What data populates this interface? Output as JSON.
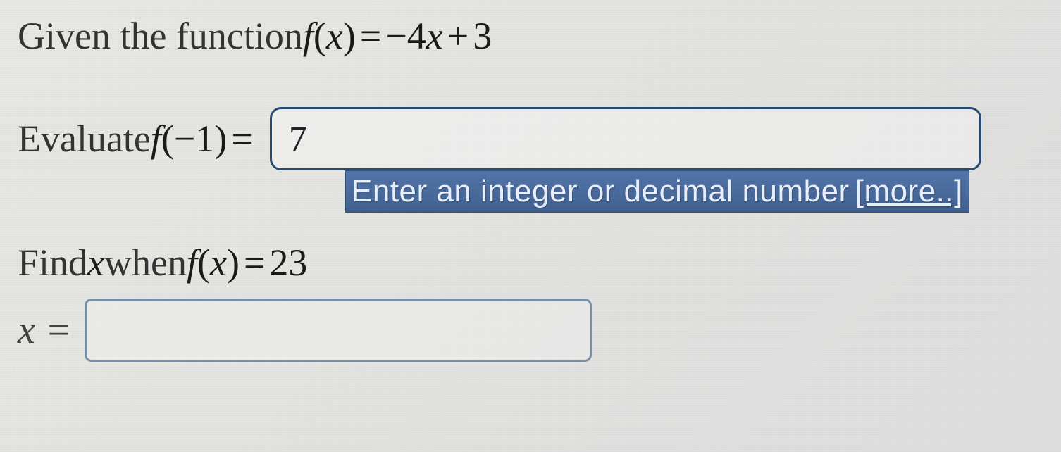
{
  "prompt": {
    "intro_text": "Given the function ",
    "function_def": "f(x) = −4x + 3"
  },
  "q1": {
    "label_text": "Evaluate ",
    "math_label": "f(−1) =",
    "input_value": "7",
    "hint_text": "Enter an integer or decimal number ",
    "hint_link": "[more..]"
  },
  "q2": {
    "label_text": "Find ",
    "var_text": "x",
    "when_text": " when ",
    "math_label": "f(x) = 23",
    "result_prefix": "x =",
    "input_value": ""
  }
}
